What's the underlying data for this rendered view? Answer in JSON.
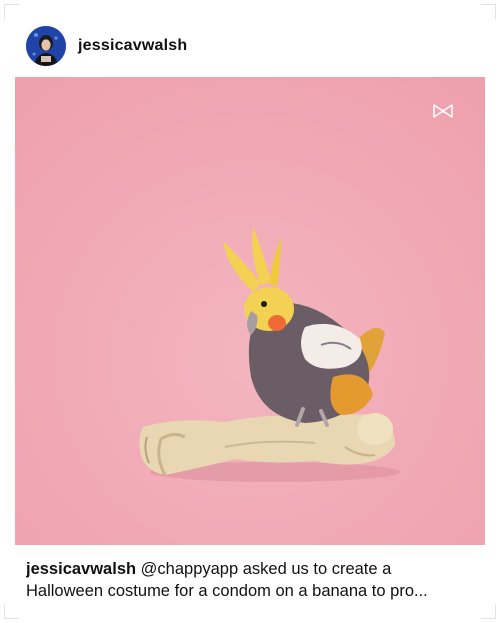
{
  "post": {
    "username": "jessicavwalsh",
    "caption": {
      "username": "jessicavwalsh",
      "line1_text": " @chappyapp asked us to create a",
      "line2_text": "Halloween costume for a condom on a banana to pro..."
    },
    "media": {
      "background_color": "#f1aab4",
      "overlay_icon": "bow-tie-icon"
    }
  }
}
